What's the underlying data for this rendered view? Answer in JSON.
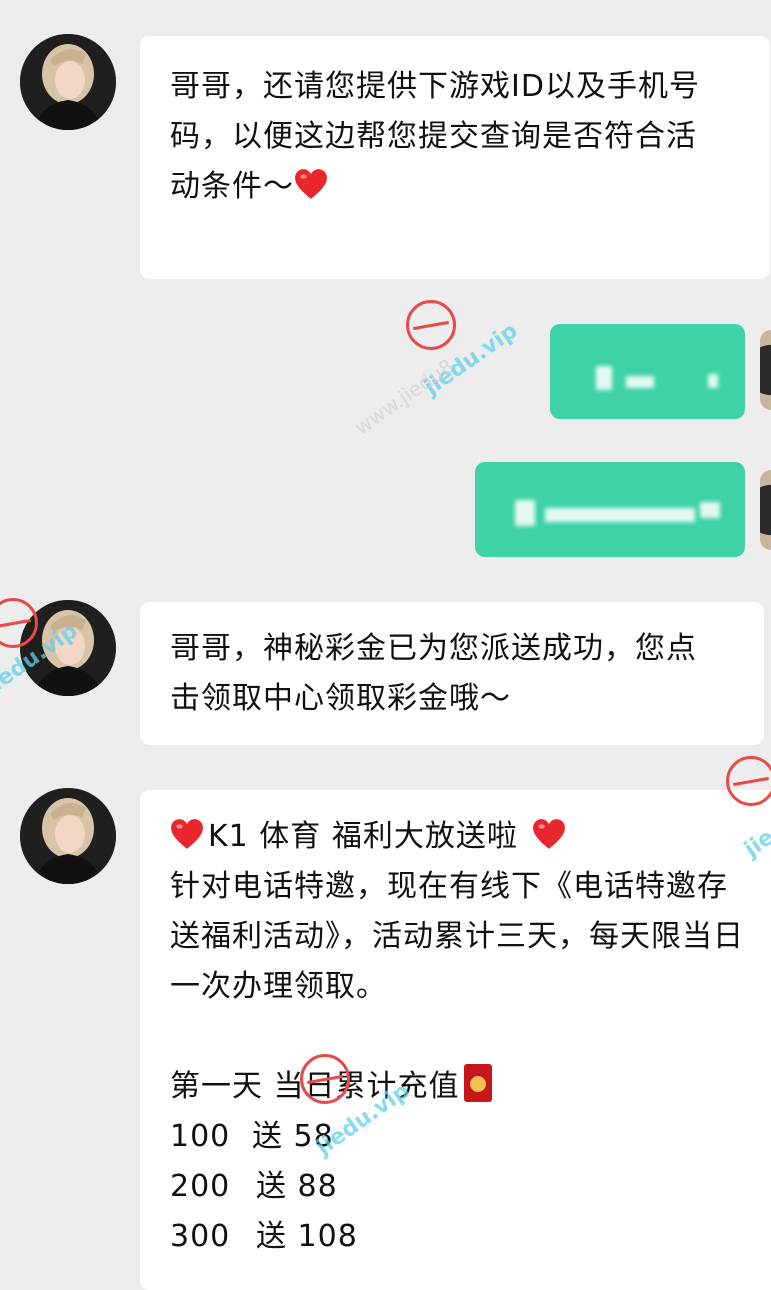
{
  "messages": [
    {
      "lines": [
        "哥哥，还请您提供下游戏ID以及手机号",
        "码，以便这边帮您提交查询是否符合活",
        "动条件～"
      ]
    },
    {
      "lines": [
        "哥哥，神秘彩金已为您派送成功，您点",
        "击领取中心领取彩金哦～"
      ]
    },
    {
      "title": "K1 体育 福利大放送啦",
      "lines": [
        "针对电话特邀，现在有线下《电话特邀存",
        "送福利活动》，活动累计三天，每天限当日",
        "一次办理领取。"
      ],
      "day_title": "第一天 当日累计充值",
      "tiers": [
        {
          "amount": "100",
          "bonus": "送 58"
        },
        {
          "amount": "200",
          "bonus": "送 88"
        },
        {
          "amount": "300",
          "bonus": "送 108"
        }
      ]
    }
  ],
  "watermark": {
    "site": "jiedu.vip",
    "site_short": "jiedu",
    "gray_text": "www.jiedu8"
  },
  "icons": {
    "heart": "heart-emoji-icon",
    "envelope": "red-envelope-icon",
    "avatar": "avatar"
  },
  "colors": {
    "background": "#ededed",
    "incoming_bubble": "#ffffff",
    "outgoing_bubble": "#3ed2a6",
    "heart": "#e8262d"
  }
}
